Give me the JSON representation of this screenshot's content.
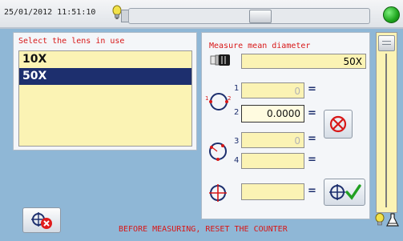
{
  "status_bar": {
    "datetime": "25/01/2012  11:51:10",
    "status_color": "#1ea51e"
  },
  "lens_panel": {
    "title": "Select the lens in use",
    "items": [
      {
        "label": "10X",
        "selected": false
      },
      {
        "label": "50X",
        "selected": true
      }
    ]
  },
  "measure_panel": {
    "title": "Measure mean diameter",
    "lens_value": "50X",
    "points_a": {
      "label_1": "1",
      "label_2": "2",
      "value_1": "0",
      "value_2": "0.0000"
    },
    "points_b": {
      "label_3": "3",
      "label_4": "4",
      "value_3": "0",
      "value_4": ""
    },
    "mean_value": "",
    "equals": "="
  },
  "footer": {
    "message": "BEFORE MEASURING, RESET THE COUNTER"
  },
  "icons": {
    "top_bulb": "lightbulb-icon",
    "lens": "microscope-lens-icon",
    "two_point_circle": "two-point-circle-icon",
    "three_point_circle": "three-point-circle-icon",
    "mean_circle": "crosshair-circle-icon",
    "clear": "clear-measurement-icon",
    "confirm": "confirm-measurement-icon",
    "reset": "reset-counter-icon",
    "bottom_bulb": "lightbulb-icon",
    "bottom_flask": "flask-icon"
  },
  "colors": {
    "accent_red": "#d81818",
    "selection_navy": "#1d2f6e",
    "field_yellow": "#fbf3b4",
    "background_blue": "#8fb7d6"
  }
}
